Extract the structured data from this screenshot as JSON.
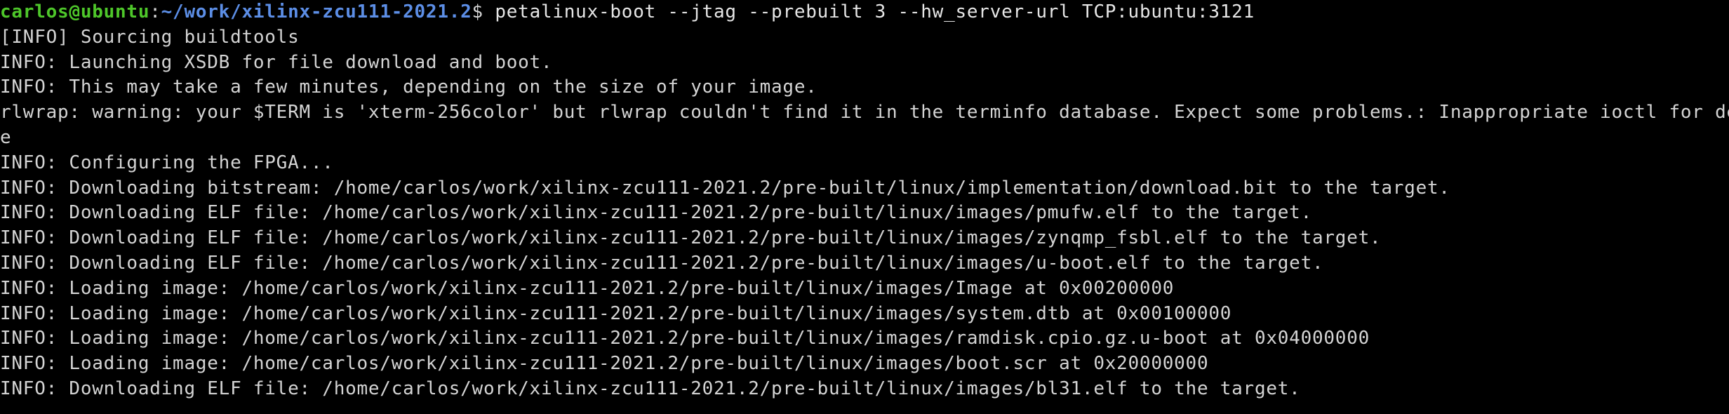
{
  "terminal": {
    "prompt": {
      "user_host": "carlos@ubuntu",
      "separator": ":",
      "path": "~/work/xilinx-zcu111-2021.2",
      "symbol": "$ ",
      "command": "petalinux-boot --jtag --prebuilt 3 --hw_server-url TCP:ubuntu:3121"
    },
    "output": [
      "[INFO] Sourcing buildtools",
      "INFO: Launching XSDB for file download and boot.",
      "INFO: This may take a few minutes, depending on the size of your image.",
      "rlwrap: warning: your $TERM is 'xterm-256color' but rlwrap couldn't find it in the terminfo database. Expect some problems.: Inappropriate ioctl for devic",
      "e",
      "INFO: Configuring the FPGA...",
      "INFO: Downloading bitstream: /home/carlos/work/xilinx-zcu111-2021.2/pre-built/linux/implementation/download.bit to the target.",
      "INFO: Downloading ELF file: /home/carlos/work/xilinx-zcu111-2021.2/pre-built/linux/images/pmufw.elf to the target.",
      "INFO: Downloading ELF file: /home/carlos/work/xilinx-zcu111-2021.2/pre-built/linux/images/zynqmp_fsbl.elf to the target.",
      "INFO: Downloading ELF file: /home/carlos/work/xilinx-zcu111-2021.2/pre-built/linux/images/u-boot.elf to the target.",
      "INFO: Loading image: /home/carlos/work/xilinx-zcu111-2021.2/pre-built/linux/images/Image at 0x00200000",
      "INFO: Loading image: /home/carlos/work/xilinx-zcu111-2021.2/pre-built/linux/images/system.dtb at 0x00100000",
      "INFO: Loading image: /home/carlos/work/xilinx-zcu111-2021.2/pre-built/linux/images/ramdisk.cpio.gz.u-boot at 0x04000000",
      "INFO: Loading image: /home/carlos/work/xilinx-zcu111-2021.2/pre-built/linux/images/boot.scr at 0x20000000",
      "INFO: Downloading ELF file: /home/carlos/work/xilinx-zcu111-2021.2/pre-built/linux/images/bl31.elf to the target."
    ]
  },
  "colors": {
    "background": "#000000",
    "text": "#d4d4d4",
    "prompt_user": "#4ec72a",
    "prompt_path": "#5c8ee6"
  }
}
